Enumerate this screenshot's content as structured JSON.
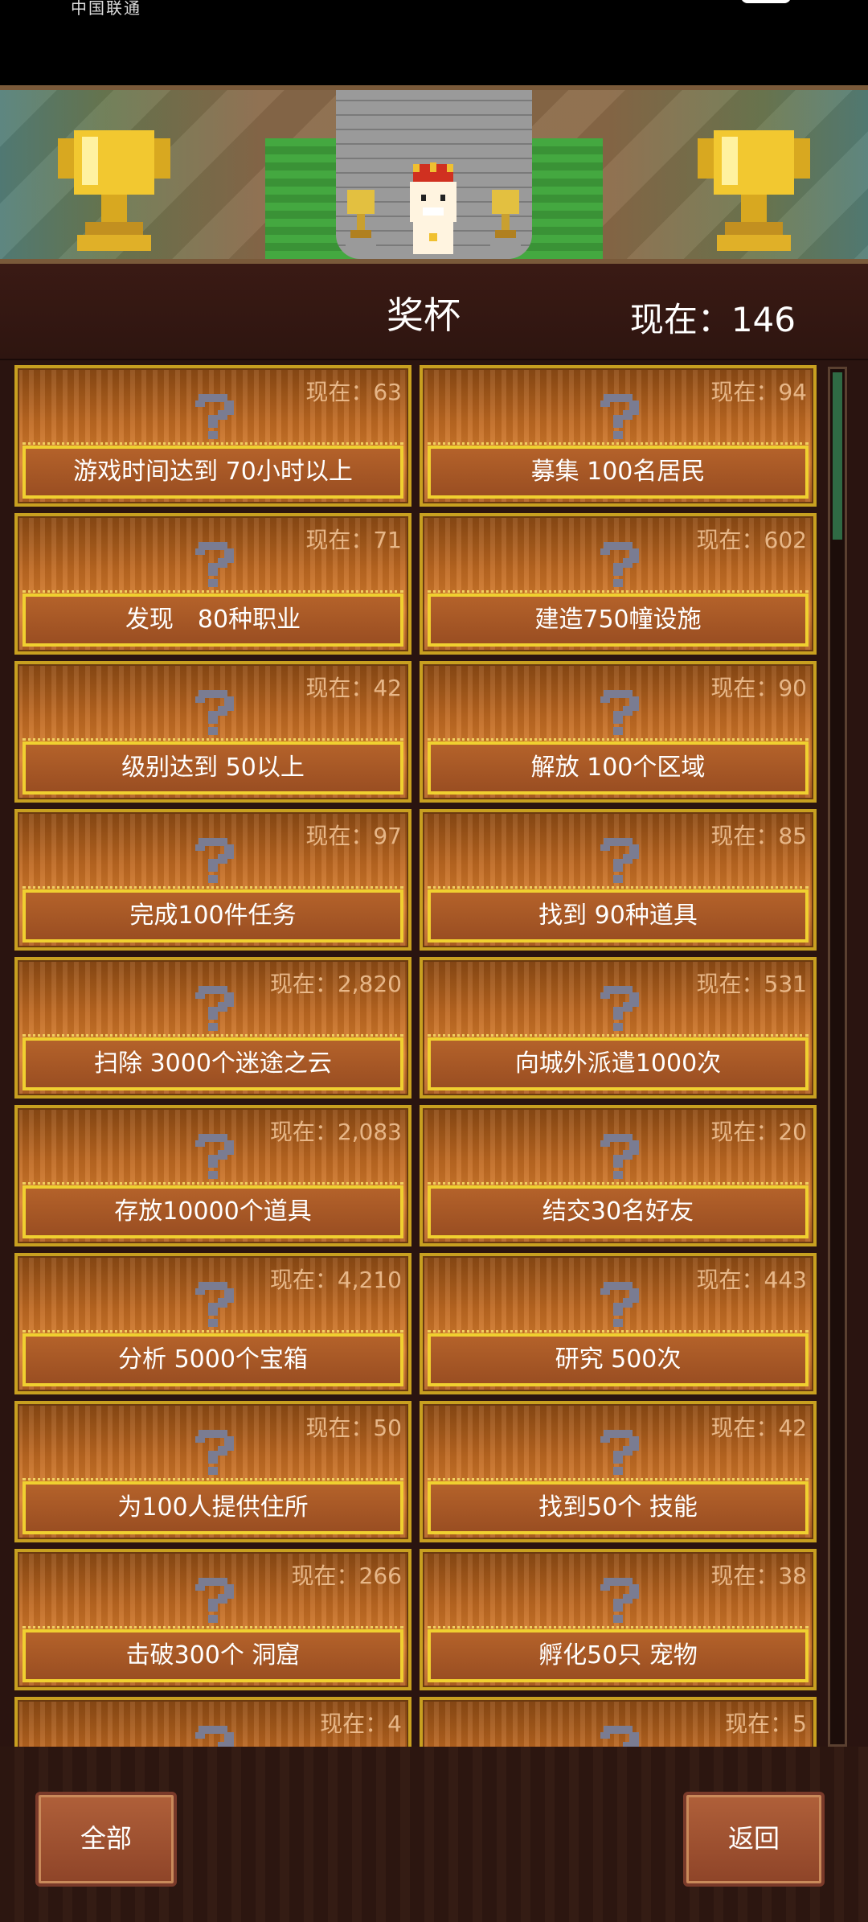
{
  "status_bar": {
    "carrier": "中国联通"
  },
  "header": {
    "title": "奖杯",
    "current_label": "现在：146"
  },
  "trophies": [
    {
      "count": "现在：63",
      "label": "游戏时间达到 70小时以上"
    },
    {
      "count": "现在：94",
      "label": "募集 100名居民"
    },
    {
      "count": "现在：71",
      "label": "发现　80种职业"
    },
    {
      "count": "现在：602",
      "label": "建造750幢设施"
    },
    {
      "count": "现在：42",
      "label": "级别达到 50以上"
    },
    {
      "count": "现在：90",
      "label": "解放 100个区域"
    },
    {
      "count": "现在：97",
      "label": "完成100件任务"
    },
    {
      "count": "现在：85",
      "label": "找到 90种道具"
    },
    {
      "count": "现在：2,820",
      "label": "扫除 3000个迷途之云"
    },
    {
      "count": "现在：531",
      "label": "向城外派遣1000次"
    },
    {
      "count": "现在：2,083",
      "label": "存放10000个道具"
    },
    {
      "count": "现在：20",
      "label": "结交30名好友"
    },
    {
      "count": "现在：4,210",
      "label": "分析 5000个宝箱"
    },
    {
      "count": "现在：443",
      "label": "研究 500次"
    },
    {
      "count": "现在：50",
      "label": "为100人提供住所"
    },
    {
      "count": "现在：42",
      "label": "找到50个 技能"
    },
    {
      "count": "现在：266",
      "label": "击破300个 洞窟"
    },
    {
      "count": "现在：38",
      "label": "孵化50只 宠物"
    },
    {
      "count": "现在：4",
      "label": ""
    },
    {
      "count": "现在：5",
      "label": ""
    }
  ],
  "footer": {
    "all_label": "全部",
    "back_label": "返回"
  },
  "colors": {
    "card_border": "#c8a020",
    "label_border": "#f0d030",
    "card_fill": "#c06a22"
  },
  "icons": {
    "card_icon": "question-mark-icon",
    "banner_icon": "trophy-icon"
  }
}
